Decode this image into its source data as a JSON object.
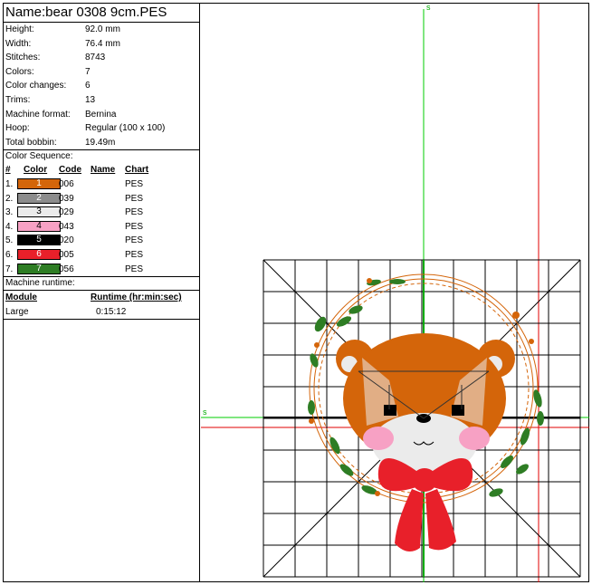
{
  "title": "Name:bear 0308 9cm.PES",
  "properties": [
    {
      "label": "Height:",
      "value": "92.0 mm"
    },
    {
      "label": "Width:",
      "value": "76.4 mm"
    },
    {
      "label": "Stitches:",
      "value": "8743"
    },
    {
      "label": "Colors:",
      "value": "7"
    },
    {
      "label": "Color changes:",
      "value": "6"
    },
    {
      "label": "Trims:",
      "value": "13"
    },
    {
      "label": "Machine format:",
      "value": "Bernina"
    },
    {
      "label": "Hoop:",
      "value": "Regular (100 x 100)"
    },
    {
      "label": "Total bobbin:",
      "value": "19.49m"
    }
  ],
  "color_sequence": {
    "title": "Color Sequence:",
    "headers": {
      "num": "#",
      "color": "Color",
      "code": "Code",
      "name": "Name",
      "chart": "Chart"
    },
    "rows": [
      {
        "num": "1.",
        "swatch": "1",
        "bg": "#d4650a",
        "fg": "#ffffff",
        "code": "006",
        "name": "",
        "chart": "PES"
      },
      {
        "num": "2.",
        "swatch": "2",
        "bg": "#8c8c8c",
        "fg": "#ffffff",
        "code": "039",
        "name": "",
        "chart": "PES"
      },
      {
        "num": "3.",
        "swatch": "3",
        "bg": "#ebebeb",
        "fg": "#000000",
        "code": "029",
        "name": "",
        "chart": "PES"
      },
      {
        "num": "4.",
        "swatch": "4",
        "bg": "#f7a1c4",
        "fg": "#000000",
        "code": "043",
        "name": "",
        "chart": "PES"
      },
      {
        "num": "5.",
        "swatch": "5",
        "bg": "#000000",
        "fg": "#ffffff",
        "code": "020",
        "name": "",
        "chart": "PES"
      },
      {
        "num": "6.",
        "swatch": "6",
        "bg": "#e8202a",
        "fg": "#ffffff",
        "code": "005",
        "name": "",
        "chart": "PES"
      },
      {
        "num": "7.",
        "swatch": "7",
        "bg": "#2e7d24",
        "fg": "#ffffff",
        "code": "056",
        "name": "",
        "chart": "PES"
      }
    ]
  },
  "runtime": {
    "title": "Machine runtime:",
    "headers": {
      "module": "Module",
      "runtime": "Runtime (hr:min:sec)"
    },
    "rows": [
      {
        "module": "Large",
        "runtime": "0:15:12"
      }
    ]
  },
  "canvas": {
    "axis_label_top": "s",
    "axis_label_left": "s",
    "colors": {
      "axis": "#00cc00",
      "limit": "#e00000",
      "grid": "#000000"
    }
  }
}
